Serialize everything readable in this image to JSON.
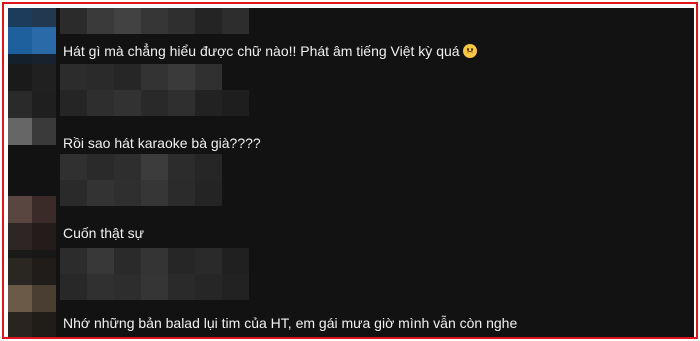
{
  "comments": [
    {
      "text": "Hát gì mà chẳng hiểu được chữ nào!! Phát âm tiếng Việt kỳ quá",
      "emoji": "disappointed-face-emoji"
    },
    {
      "text": "Rồi sao hát karaoke bà già????"
    },
    {
      "text": "Cuốn thật sự"
    },
    {
      "text": "Nhớ những bản balad lụi tim của HT, em gái mưa giờ mình vẫn còn nghe"
    }
  ],
  "colors": {
    "frame_border": "#e0141c",
    "panel_bg": "#121212",
    "text": "#f1f1f1"
  }
}
